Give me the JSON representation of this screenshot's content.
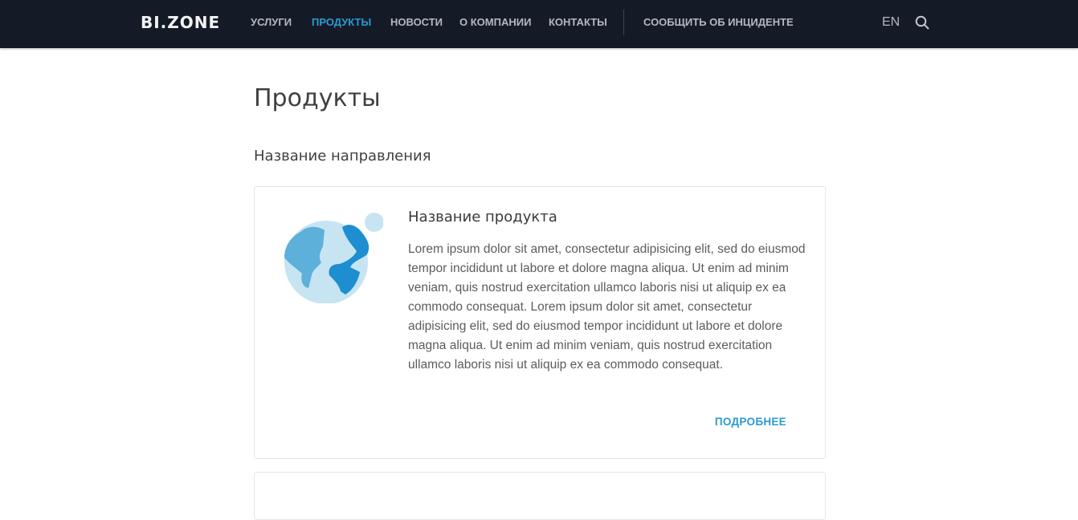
{
  "header": {
    "logo": "BI.ZONE",
    "nav": [
      {
        "label": "УСЛУГИ",
        "active": false
      },
      {
        "label": "ПРОДУКТЫ",
        "active": true
      },
      {
        "label": "НОВОСТИ",
        "active": false
      },
      {
        "label": "О КОМПАНИИ",
        "active": false
      },
      {
        "label": "КОНТАКТЫ",
        "active": false
      }
    ],
    "report_incident": "СООБЩИТЬ ОБ ИНЦИДЕНТЕ",
    "lang": "EN",
    "search_icon": "search-icon"
  },
  "main": {
    "page_title": "Продукты",
    "section_title": "Название направления",
    "card": {
      "icon": "globe-icon",
      "title": "Название продукта",
      "description": "Lorem ipsum dolor sit amet, consectetur adipisicing elit, sed do eiusmod tempor incididunt ut labore et dolore magna aliqua. Ut enim ad minim veniam, quis nostrud exercitation ullamco laboris nisi ut aliquip ex ea commodo consequat. Lorem ipsum dolor sit amet, consectetur adipisicing elit, sed do eiusmod tempor incididunt ut labore et dolore magna aliqua. Ut enim ad minim veniam, quis nostrud exercitation ullamco laboris nisi ut aliquip ex ea commodo consequat.",
      "more_label": "ПОДРОБНЕЕ"
    }
  },
  "colors": {
    "header_bg": "#151b26",
    "nav_text": "#b3b8c0",
    "accent": "#2c9ad3",
    "globe_light": "#c7e4f3",
    "globe_mid": "#5db0d9",
    "globe_dark": "#1d8ecf"
  }
}
